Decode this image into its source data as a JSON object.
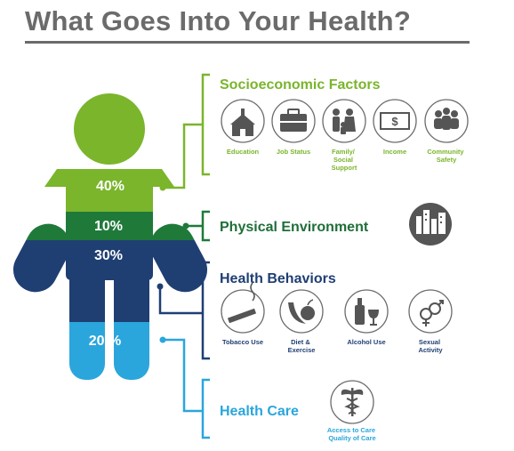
{
  "title": "What Goes Into Your Health?",
  "figure": {
    "segments": [
      {
        "pct": "40%",
        "color": "#7ab52c"
      },
      {
        "pct": "10%",
        "color": "#1f7a3a"
      },
      {
        "pct": "30%",
        "color": "#1f3f73"
      },
      {
        "pct": "20 %",
        "color": "#2aa6dc"
      }
    ]
  },
  "categories": {
    "socioeconomic": {
      "title": "Socioeconomic Factors",
      "items": [
        {
          "label_lines": [
            "Education"
          ],
          "icon": "schoolhouse-icon"
        },
        {
          "label_lines": [
            "Job Status"
          ],
          "icon": "briefcase-icon"
        },
        {
          "label_lines": [
            "Family/",
            "Social",
            "Support"
          ],
          "icon": "family-icon"
        },
        {
          "label_lines": [
            "Income"
          ],
          "icon": "dollar-bill-icon"
        },
        {
          "label_lines": [
            "Community",
            "Safety"
          ],
          "icon": "community-icon"
        }
      ]
    },
    "physical": {
      "title": "Physical Environment",
      "icon": "city-skyline-icon"
    },
    "behaviors": {
      "title": "Health Behaviors",
      "items": [
        {
          "label_lines": [
            "Tobacco Use"
          ],
          "icon": "cigarette-icon"
        },
        {
          "label_lines": [
            "Diet &",
            "Exercise"
          ],
          "icon": "banana-apple-icon"
        },
        {
          "label_lines": [
            "Alcohol Use"
          ],
          "icon": "bottle-glass-icon"
        },
        {
          "label_lines": [
            "Sexual",
            "Activity"
          ],
          "icon": "gender-symbols-icon"
        }
      ]
    },
    "care": {
      "title": "Health Care",
      "items": [
        {
          "label_lines": [
            "Access to Care",
            "Quality of Care"
          ],
          "icon": "caduceus-icon"
        }
      ]
    }
  },
  "colors": {
    "title": "#6b6b6b",
    "green": "#7ab52c",
    "dark_green": "#1f7a3a",
    "navy": "#1f3f73",
    "light_blue": "#2aa6dc"
  }
}
